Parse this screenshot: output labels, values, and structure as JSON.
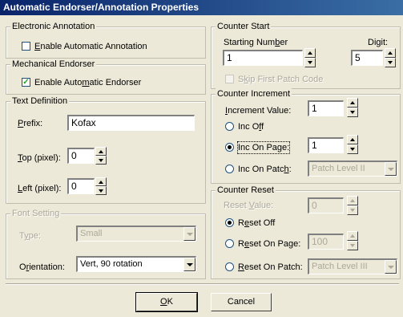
{
  "title": "Automatic Endorser/Annotation Properties",
  "electronic": {
    "group": "Electronic Annotation",
    "enable_label": "Enable Automatic Annotation",
    "enable_underline": "E",
    "enable_rest": "nable Automatic Annotation",
    "checked": false
  },
  "mechanical": {
    "group": "Mechanical Endorser",
    "enable_pre": "Enable Auto",
    "enable_u": "m",
    "enable_post": "atic Endorser",
    "checked": true
  },
  "text_def": {
    "group": "Text Definition",
    "prefix_u": "P",
    "prefix_rest": "refix:",
    "prefix_value": "Kofax",
    "top_u": "T",
    "top_rest": "op (pixel):",
    "top_value": "0",
    "left_u": "L",
    "left_rest": "eft (pixel):",
    "left_value": "0"
  },
  "font": {
    "group": "Font Setting",
    "type_pre": "T",
    "type_u": "y",
    "type_post": "pe:",
    "type_value": "Small",
    "orient_pre": "O",
    "orient_u": "r",
    "orient_post": "ientation:",
    "orient_value": "Vert, 90 rotation"
  },
  "counter_start": {
    "group": "Counter Start",
    "start_pre": "Starting Num",
    "start_u": "b",
    "start_post": "er",
    "start_value": "1",
    "digit_pre": "Di",
    "digit_u": "g",
    "digit_post": "it:",
    "digit_value": "5",
    "skip_pre": "S",
    "skip_u": "k",
    "skip_post": "ip First Patch Code"
  },
  "counter_inc": {
    "group": "Counter Increment",
    "inc_u": "I",
    "inc_rest": "ncrement Value:",
    "inc_value": "1",
    "off_pre": "Inc O",
    "off_u": "f",
    "off_post": "f",
    "page_pre": "Inc On Pa",
    "page_u": "g",
    "page_post": "e:",
    "page_value": "1",
    "patch_pre": "Inc On Patc",
    "patch_u": "h",
    "patch_post": ":",
    "patch_value": "Patch Level II"
  },
  "counter_reset": {
    "group": "Counter Reset",
    "reset_value_pre": "Reset ",
    "reset_value_u": "V",
    "reset_value_post": "alue:",
    "reset_value": "0",
    "off_pre": "R",
    "off_u": "e",
    "off_post": "set Off",
    "page_pre": "R",
    "page_u": "e",
    "page_post": "set On Page:",
    "page_value": "100",
    "patch_u": "R",
    "patch_post": "eset On Patch:",
    "patch_value": "Patch Level III"
  },
  "buttons": {
    "ok_u": "O",
    "ok_post": "K",
    "cancel": "Cancel"
  }
}
